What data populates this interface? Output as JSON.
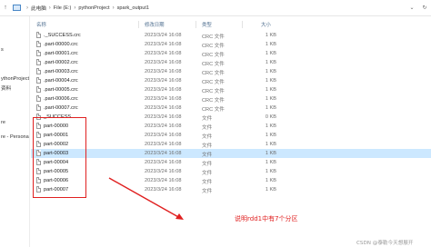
{
  "address_bar": {
    "crumbs": [
      "此电脑",
      "File (E:)",
      "pythonProject",
      "spark_output1"
    ]
  },
  "left_pane": {
    "items": [
      "s",
      "ythonProject",
      "资料",
      "re",
      "re - Persona"
    ]
  },
  "columns": {
    "name": "名称",
    "date": "修改日期",
    "type": "类型",
    "size": "大小"
  },
  "files": [
    {
      "name": "._SUCCESS.crc",
      "date": "2023/3/24 16:08",
      "type": "CRC 文件",
      "size": "1 KB"
    },
    {
      "name": ".part-00000.crc",
      "date": "2023/3/24 16:08",
      "type": "CRC 文件",
      "size": "1 KB"
    },
    {
      "name": ".part-00001.crc",
      "date": "2023/3/24 16:08",
      "type": "CRC 文件",
      "size": "1 KB"
    },
    {
      "name": ".part-00002.crc",
      "date": "2023/3/24 16:08",
      "type": "CRC 文件",
      "size": "1 KB"
    },
    {
      "name": ".part-00003.crc",
      "date": "2023/3/24 16:08",
      "type": "CRC 文件",
      "size": "1 KB"
    },
    {
      "name": ".part-00004.crc",
      "date": "2023/3/24 16:08",
      "type": "CRC 文件",
      "size": "1 KB"
    },
    {
      "name": ".part-00005.crc",
      "date": "2023/3/24 16:08",
      "type": "CRC 文件",
      "size": "1 KB"
    },
    {
      "name": ".part-00006.crc",
      "date": "2023/3/24 16:08",
      "type": "CRC 文件",
      "size": "1 KB"
    },
    {
      "name": ".part-00007.crc",
      "date": "2023/3/24 16:08",
      "type": "CRC 文件",
      "size": "1 KB"
    },
    {
      "name": "_SUCCESS",
      "date": "2023/3/24 16:08",
      "type": "文件",
      "size": "0 KB"
    },
    {
      "name": "part-00000",
      "date": "2023/3/24 16:08",
      "type": "文件",
      "size": "1 KB"
    },
    {
      "name": "part-00001",
      "date": "2023/3/24 16:08",
      "type": "文件",
      "size": "1 KB"
    },
    {
      "name": "part-00002",
      "date": "2023/3/24 16:08",
      "type": "文件",
      "size": "1 KB"
    },
    {
      "name": "part-00003",
      "date": "2023/3/24 16:08",
      "type": "文件",
      "size": "1 KB",
      "selected": true
    },
    {
      "name": "part-00004",
      "date": "2023/3/24 16:08",
      "type": "文件",
      "size": "1 KB"
    },
    {
      "name": "part-00005",
      "date": "2023/3/24 16:08",
      "type": "文件",
      "size": "1 KB"
    },
    {
      "name": "part-00006",
      "date": "2023/3/24 16:08",
      "type": "文件",
      "size": "1 KB"
    },
    {
      "name": "part-00007",
      "date": "2023/3/24 16:08",
      "type": "文件",
      "size": "1 KB"
    }
  ],
  "annotation": {
    "note": "说明rdd1中有7个分区",
    "color": "#e02020"
  },
  "watermark": "CSDN @泰勒今天想展开",
  "colors": {
    "selected_row": "#cce8ff",
    "header_text": "#4d6d8e"
  }
}
